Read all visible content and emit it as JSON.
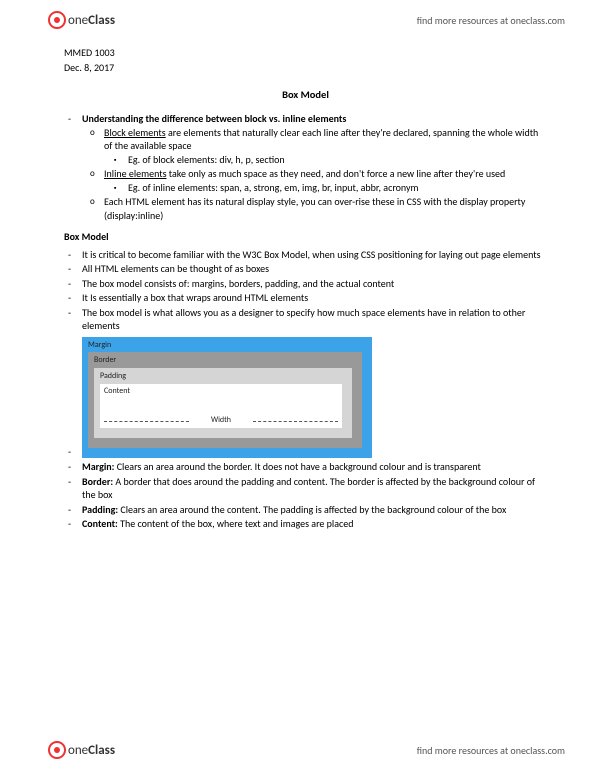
{
  "brand": {
    "part1": "one",
    "part2": "Class"
  },
  "header_link": "find more resources at oneclass.com",
  "footer_link": "find more resources at oneclass.com",
  "meta": {
    "course": "MMED 1003",
    "date": "Dec. 8, 2017"
  },
  "title": "Box Model",
  "section1": {
    "heading": "Understanding the difference between block vs. inline elements",
    "block_def_pre": "Block elements",
    "block_def_post": " are elements that naturally clear each line after they're declared, spanning the whole width of the available space",
    "block_eg": "Eg. of block elements: div, h, p, section",
    "inline_def_pre": "Inline elements",
    "inline_def_post": " take only as much space as they need, and don't force a new line after they're used",
    "inline_eg": "Eg. of inline elements: span, a, strong, em, img, br, input, abbr, acronym",
    "display_note": "Each HTML element has its natural display style, you can over-rise these in CSS with the display property (display:inline)"
  },
  "section2": {
    "heading": "Box Model",
    "b1": "It is critical to become familiar with the W3C Box Model, when using CSS positioning for laying out page elements",
    "b2": "All HTML elements can be thought of as boxes",
    "b3": "The box model consists of: margins, borders, padding, and the actual content",
    "b4": "It Is essentially a box that wraps around HTML elements",
    "b5": "The box model is what allows you as a designer to specify how much space elements have in relation to other elements"
  },
  "diagram": {
    "margin": "Margin",
    "border": "Border",
    "padding": "Padding",
    "content": "Content",
    "width": "Width"
  },
  "defs": {
    "margin_label": "Margin:",
    "margin_text": " Clears an area around the border. It does not have a background colour and is transparent",
    "border_label": "Border:",
    "border_text": " A border that does around the padding and content. The border is affected by the background colour of the box",
    "padding_label": "Padding:",
    "padding_text": " Clears an area around the content. The padding is affected by the background colour of the box",
    "content_label": "Content:",
    "content_text": " The content of the box, where text and images are placed"
  }
}
